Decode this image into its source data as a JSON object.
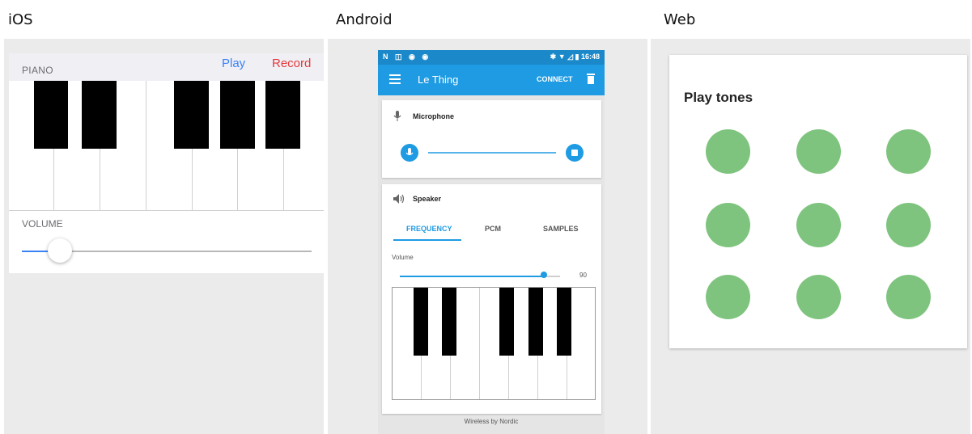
{
  "columns": {
    "ios": "iOS",
    "android": "Android",
    "web": "Web"
  },
  "ios": {
    "piano_label": "PIANO",
    "play_label": "Play",
    "record_label": "Record",
    "volume_label": "VOLUME",
    "volume_value": 0.13
  },
  "android": {
    "status_icons": "N ◫ ◉ ◉",
    "status_time": "✱ ▼ ◿ ▮ 16:48",
    "toolbar_title": "Le Thing",
    "connect_label": "CONNECT",
    "microphone_label": "Microphone",
    "speaker_label": "Speaker",
    "tabs": [
      "FREQUENCY",
      "PCM",
      "SAMPLES"
    ],
    "active_tab": "FREQUENCY",
    "volume_label": "Volume",
    "volume_value": "90",
    "footer": "Wireless by Nordic"
  },
  "web": {
    "title": "Play tones",
    "tone_color": "#7fc47e",
    "tone_count": 9
  },
  "colors": {
    "ios_accent": "#3b82f6",
    "ios_record": "#e5393c",
    "android_primary": "#1e9be3",
    "tone_green": "#7fc47e",
    "panel_bg": "#ebebeb"
  }
}
